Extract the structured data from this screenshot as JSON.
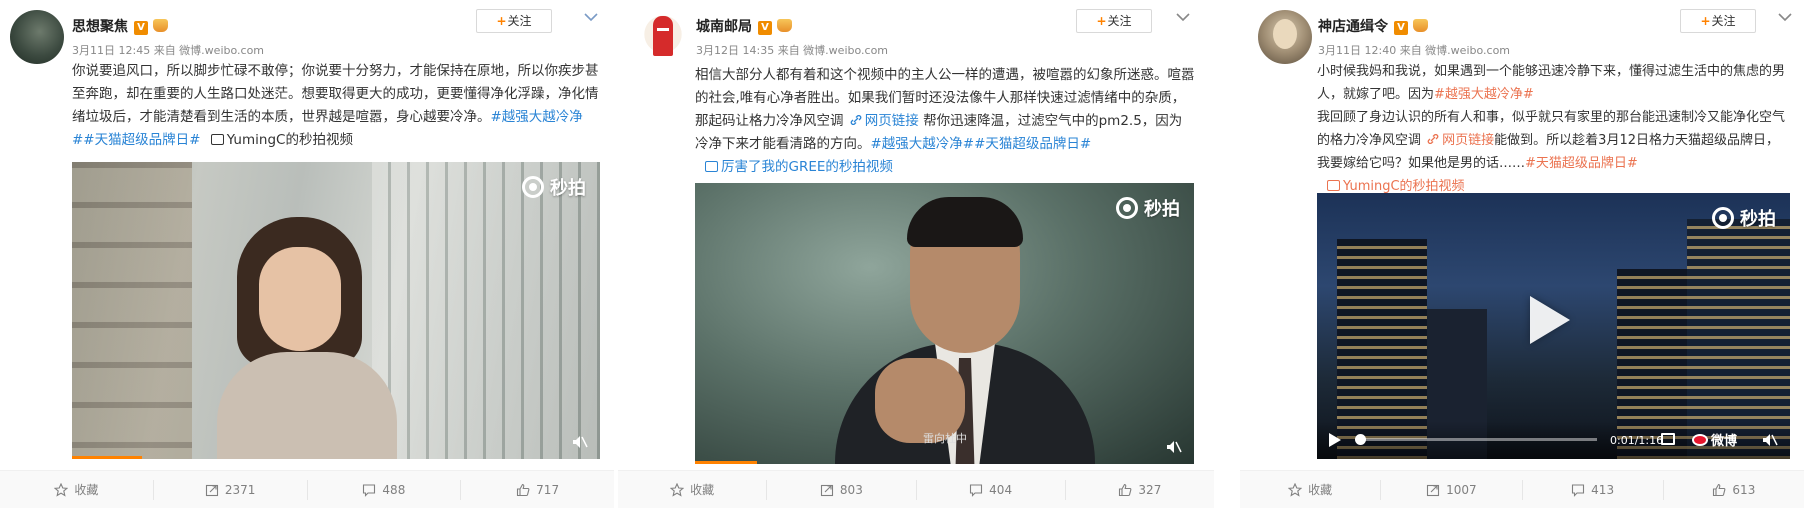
{
  "accent": "#ff8200",
  "link_color": "#eb7350",
  "topic_blue": "#2a84d5",
  "posts": [
    {
      "author": "思想聚焦",
      "verified": "V",
      "meta": "3月11日 12:45 来自 微博.weibo.com",
      "follow_label": "关注",
      "text_plain": "你说要追风口，所以脚步忙碌不敢停；你说要十分努力，才能保持在原地，所以你疾步甚至奔跑，却在重要的人生路口处迷茫。想要取得更大的成功，更要懂得净化浮躁，净化情绪垃圾后，才能清楚看到生活的本质，世界越是喧嚣，身心越要冷净。",
      "hashtags": "#越强大越冷净##天猫超级品牌日#",
      "video_link": "YumingC的秒拍视频",
      "watermark": "秒拍",
      "actions": {
        "fav": "收藏",
        "repost": "2371",
        "comment": "488",
        "like": "717"
      }
    },
    {
      "author": "城南邮局",
      "verified": "V",
      "meta": "3月12日 14:35 来自 微博.weibo.com",
      "follow_label": "关注",
      "text_plain": "相信大部分人都有着和这个视频中的主人公一样的遭遇，被喧嚣的幻象所迷惑。喧嚣的社会,唯有心净者胜出。如果我们暂时还没法像牛人那样快速过滤情绪中的杂质，那起码让格力冷净风空调",
      "web_link": "网页链接",
      "text_plain_2": "帮你迅速降温，过滤空气中的pm2.5，因为冷净下来才能看清路的方向。",
      "hashtags": "#越强大越冷净##天猫超级品牌日#",
      "video_link": "厉害了我的GREE的秒拍视频",
      "watermark": "秒拍",
      "video_caption": "雷向杜中",
      "actions": {
        "fav": "收藏",
        "repost": "803",
        "comment": "404",
        "like": "327"
      }
    },
    {
      "author": "神店通缉令",
      "verified": "V",
      "meta": "3月11日 12:40 来自 微博.weibo.com",
      "follow_label": "关注",
      "text_plain": "小时候我妈和我说，如果遇到一个能够迅速冷静下来，懂得过滤生活中的焦虑的男人，就嫁了吧。因为",
      "hashtag_1": "#越强大越冷净#",
      "text_plain_2": "我回顾了身边认识的所有人和事，似乎就只有家里的那台能迅速制冷又能净化空气的格力冷净风空调",
      "web_link": "网页链接",
      "text_plain_3": "能做到。所以趁着3月12日格力天猫超级品牌日，我要嫁给它吗？如果他是男的话……",
      "hashtag_2": "#天猫超级品牌日#",
      "video_link": "YumingC的秒拍视频",
      "watermark": "秒拍",
      "video_time": "0:01/1:16",
      "weibo_logo": "微博",
      "actions": {
        "fav": "收藏",
        "repost": "1007",
        "comment": "413",
        "like": "613"
      }
    }
  ]
}
